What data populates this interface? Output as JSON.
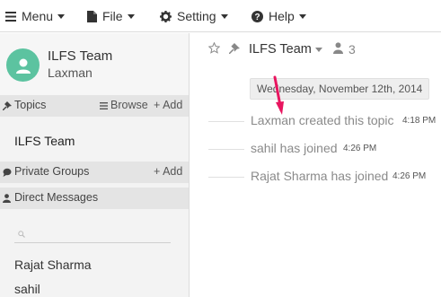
{
  "menubar": {
    "menu_label": "Menu",
    "file_label": "File",
    "setting_label": "Setting",
    "help_label": "Help"
  },
  "sidebar": {
    "team_name": "ILFS Team",
    "user_name": "Laxman",
    "avatar_color": "#5cc3a0",
    "topics": {
      "label": "Topics",
      "browse_label": "Browse",
      "add_label": "+ Add",
      "items": [
        "ILFS Team"
      ]
    },
    "private_groups": {
      "label": "Private Groups",
      "add_label": "+ Add"
    },
    "direct_messages": {
      "label": "Direct Messages",
      "users": [
        "Rajat Sharma",
        "sahil"
      ]
    }
  },
  "main": {
    "header": {
      "title": "ILFS Team",
      "member_count": "3"
    },
    "date_divider": "Wednesday, November 12th, 2014",
    "messages": [
      {
        "text": "Laxman created this topic",
        "time": "4:18 PM"
      },
      {
        "text": "sahil has joined",
        "time": "4:26 PM"
      },
      {
        "text": "Rajat Sharma has joined",
        "time": "4:26 PM"
      }
    ]
  },
  "annotation_color": "#e8155f"
}
